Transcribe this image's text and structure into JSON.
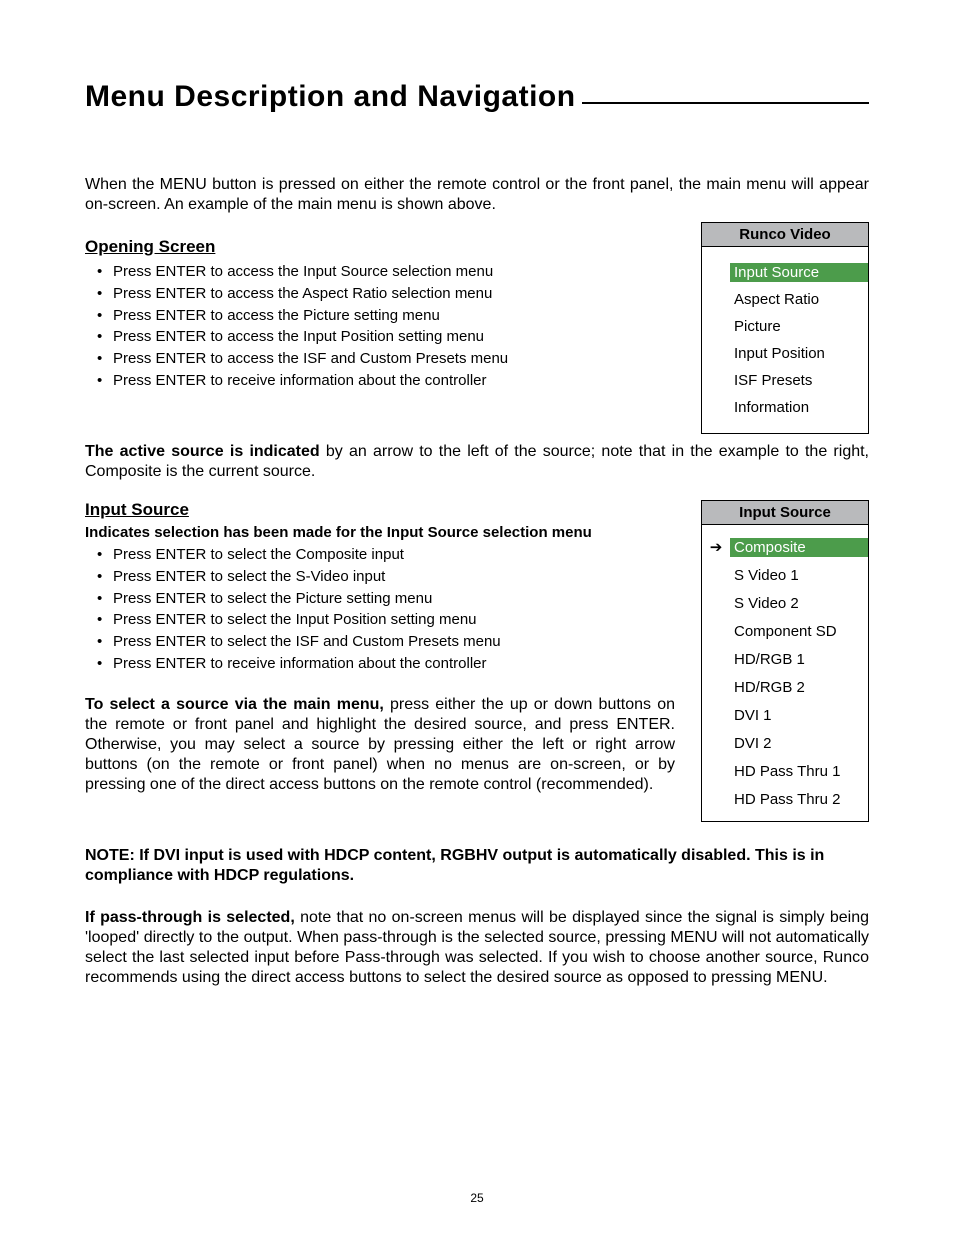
{
  "title": "Menu Description and Navigation",
  "intro": "When the MENU button is pressed on either the remote control or the front panel, the main menu will appear on-screen. An example of the main menu is shown above.",
  "opening": {
    "heading": "Opening Screen",
    "items": [
      "Press ENTER to access the Input Source selection menu",
      "Press ENTER to access the Aspect Ratio selection menu",
      "Press ENTER to access the Picture setting menu",
      "Press ENTER to access the Input Position setting menu",
      "Press ENTER to access the ISF and Custom Presets menu",
      "Press ENTER to receive information about the controller"
    ]
  },
  "menu1": {
    "header": "Runco Video",
    "items": [
      "Input Source",
      "Aspect Ratio",
      "Picture",
      "Input Position",
      "ISF Presets",
      "Information"
    ],
    "selected_index": 0
  },
  "active_source_lead": "The active source is indicated",
  "active_source_rest": " by an arrow to the left of the source; note that in the example to the right, Composite is the current source.",
  "input_source": {
    "heading": "Input Source",
    "subhead": "Indicates selection has been made for the Input Source selection menu",
    "items": [
      "Press ENTER to select the Composite input",
      "Press ENTER to select the S-Video input",
      "Press ENTER to select the Picture setting menu",
      "Press ENTER to select the Input Position setting menu",
      "Press ENTER to select the ISF and Custom Presets menu",
      "Press ENTER to receive information about the controller"
    ]
  },
  "menu2": {
    "header": "Input Source",
    "items": [
      "Composite",
      "S Video 1",
      "S Video 2",
      "Component  SD",
      "HD/RGB 1",
      "HD/RGB 2",
      "DVI 1",
      "DVI 2",
      "HD Pass Thru 1",
      "HD Pass Thru 2"
    ],
    "selected_index": 0
  },
  "select_lead": "To select a source via the main menu,",
  "select_rest": " press either the up or down buttons on the remote or front panel and highlight the desired source, and press ENTER. Otherwise, you may select a source by pressing either the left or right arrow buttons (on the remote or front panel) when no menus are on-screen, or by pressing one of the direct access buttons on the remote control (recommended).",
  "note": "NOTE: If DVI input is used with HDCP content, RGBHV output is automatically disabled. This is in compliance with HDCP regulations.",
  "pass_lead": "If pass-through is selected,",
  "pass_rest": " note that no on-screen menus will be displayed since the signal is simply being 'looped' directly to the output. When pass-through is the selected source, pressing MENU will not automatically select the last selected input before Pass-through was selected. If you wish to choose another source, Runco recommends using the direct access buttons to select the desired source as opposed to pressing MENU.",
  "page_number": "25",
  "arrow_glyph": "➔"
}
